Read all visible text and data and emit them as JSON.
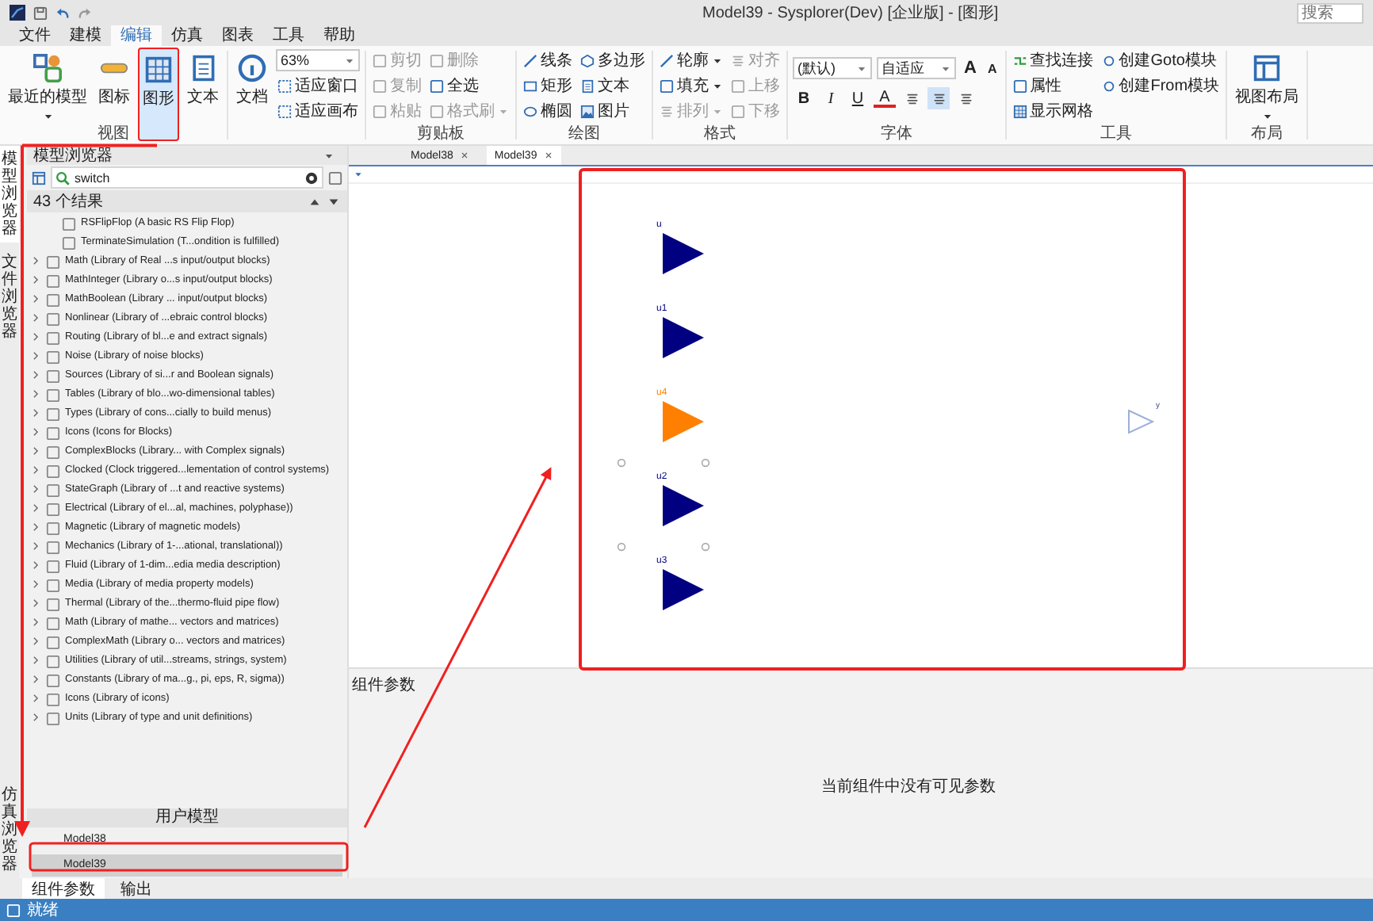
{
  "window": {
    "title": "Model39 - Sysplorer(Dev) [企业版] - [图形]",
    "search_placeholder": "搜索"
  },
  "menu": [
    {
      "label": "文件",
      "selected": false
    },
    {
      "label": "建模",
      "selected": false
    },
    {
      "label": "编辑",
      "selected": true
    },
    {
      "label": "仿真",
      "selected": false
    },
    {
      "label": "图表",
      "selected": false
    },
    {
      "label": "工具",
      "selected": false
    },
    {
      "label": "帮助",
      "selected": false
    }
  ],
  "ribbon": [
    {
      "label": "视图",
      "kind": "grid",
      "items": [
        {
          "kind": "large",
          "label": "最近的模型",
          "selected": false,
          "dropdown": true
        },
        {
          "kind": "large",
          "label": "图标",
          "selected": false,
          "dropdown": false
        },
        {
          "kind": "large",
          "label": "图形",
          "selected": true,
          "dropdown": false
        },
        {
          "kind": "large",
          "label": "文本",
          "selected": false,
          "dropdown": false
        }
      ]
    },
    {
      "kind": "grid",
      "items": [
        {
          "kind": "large",
          "label": "文档",
          "selected": false,
          "dropdown": false
        },
        {
          "kind": "combo",
          "value": "63%"
        },
        {
          "kind": "small",
          "label": "适应窗口",
          "disabled": false,
          "dropdown": false
        },
        {
          "kind": "small",
          "label": "适应画布",
          "disabled": false,
          "dropdown": false
        }
      ]
    },
    {
      "label": "剪贴板",
      "kind": "grid",
      "items": [
        {
          "kind": "small",
          "label": "剪切",
          "disabled": true,
          "dropdown": false
        },
        {
          "kind": "small",
          "label": "复制",
          "disabled": true,
          "dropdown": false
        },
        {
          "kind": "small",
          "label": "粘贴",
          "disabled": true,
          "dropdown": false
        },
        {
          "kind": "small",
          "label": "删除",
          "disabled": true,
          "dropdown": false
        },
        {
          "kind": "small",
          "label": "全选",
          "disabled": false,
          "dropdown": false
        },
        {
          "kind": "small",
          "label": "格式刷",
          "disabled": true,
          "dropdown": true
        }
      ]
    },
    {
      "label": "绘图",
      "kind": "grid",
      "items": [
        {
          "kind": "small",
          "label": "线条",
          "disabled": false,
          "dropdown": false
        },
        {
          "kind": "small",
          "label": "矩形",
          "disabled": false,
          "dropdown": false
        },
        {
          "kind": "small",
          "label": "椭圆",
          "disabled": false,
          "dropdown": false
        },
        {
          "kind": "small",
          "label": "多边形",
          "disabled": false,
          "dropdown": false
        },
        {
          "kind": "small",
          "label": "文本",
          "disabled": false,
          "dropdown": false
        },
        {
          "kind": "small",
          "label": "图片",
          "disabled": false,
          "dropdown": false
        }
      ]
    },
    {
      "label": "格式",
      "kind": "grid",
      "items": [
        {
          "kind": "small",
          "label": "轮廓",
          "disabled": false,
          "dropdown": true
        },
        {
          "kind": "small",
          "label": "填充",
          "disabled": false,
          "dropdown": true
        },
        {
          "kind": "small",
          "label": "排列",
          "disabled": true,
          "dropdown": true
        },
        {
          "kind": "small",
          "label": "对齐",
          "disabled": true,
          "dropdown": false
        },
        {
          "kind": "small",
          "label": "上移",
          "disabled": true,
          "dropdown": false
        },
        {
          "kind": "small",
          "label": "下移",
          "disabled": true,
          "dropdown": false
        }
      ]
    },
    {
      "label": "字体",
      "kind": "font",
      "combos": [
        "(默认)",
        "自适应"
      ],
      "size_buttons": [
        "A",
        "A"
      ],
      "style_buttons": [
        "B",
        "I",
        "U",
        "A"
      ],
      "align": [
        {
          "selected": false
        },
        {
          "selected": true
        },
        {
          "selected": false
        }
      ]
    },
    {
      "label": "工具",
      "kind": "grid",
      "items": [
        {
          "kind": "small",
          "label": "查找连接",
          "disabled": false,
          "dropdown": false
        },
        {
          "kind": "small",
          "label": "属性",
          "disabled": false,
          "dropdown": false
        },
        {
          "kind": "small",
          "label": "显示网格",
          "disabled": false,
          "dropdown": false
        },
        {
          "kind": "small",
          "label": "创建Goto模块",
          "disabled": false,
          "dropdown": false
        },
        {
          "kind": "small",
          "label": "创建From模块",
          "disabled": false,
          "dropdown": false
        }
      ]
    },
    {
      "label": "布局",
      "kind": "grid",
      "items": [
        {
          "kind": "large",
          "label": "视图布局",
          "selected": false,
          "dropdown": true
        }
      ]
    }
  ],
  "side_tabs": [
    {
      "label": "模型浏览器",
      "selected": true
    },
    {
      "label": "文件浏览器",
      "selected": false
    }
  ],
  "side_tabs_bottom": [
    {
      "label": "仿真浏览器",
      "selected": false
    }
  ],
  "browser": {
    "title": "模型浏览器",
    "search": "switch",
    "result_count": "43 个结果",
    "items": [
      {
        "label": "RSFlipFlop (A basic RS Flip Flop)",
        "expandable": false
      },
      {
        "label": "TerminateSimulation (T...ondition is fulfilled)",
        "expandable": false
      },
      {
        "label": "Math (Library of Real ...s input/output blocks)",
        "expandable": true
      },
      {
        "label": "MathInteger (Library o...s input/output blocks)",
        "expandable": true
      },
      {
        "label": "MathBoolean (Library ... input/output blocks)",
        "expandable": true
      },
      {
        "label": "Nonlinear (Library of ...ebraic control blocks)",
        "expandable": true
      },
      {
        "label": "Routing (Library of bl...e and extract signals)",
        "expandable": true
      },
      {
        "label": "Noise (Library of noise blocks)",
        "expandable": true
      },
      {
        "label": "Sources (Library of si...r and Boolean signals)",
        "expandable": true
      },
      {
        "label": "Tables (Library of blo...wo-dimensional tables)",
        "expandable": true
      },
      {
        "label": "Types (Library of cons...cially to build menus)",
        "expandable": true
      },
      {
        "label": "Icons (Icons for Blocks)",
        "expandable": true
      },
      {
        "label": "ComplexBlocks (Library... with Complex signals)",
        "expandable": true
      },
      {
        "label": "Clocked (Clock triggered...lementation of control systems)",
        "expandable": true
      },
      {
        "label": "StateGraph (Library of ...t and reactive systems)",
        "expandable": true
      },
      {
        "label": "Electrical (Library of el...al, machines, polyphase))",
        "expandable": true
      },
      {
        "label": "Magnetic (Library of magnetic models)",
        "expandable": true
      },
      {
        "label": "Mechanics (Library of 1-...ational, translational))",
        "expandable": true
      },
      {
        "label": "Fluid (Library of 1-dim...edia media description)",
        "expandable": true
      },
      {
        "label": "Media (Library of media property models)",
        "expandable": true
      },
      {
        "label": "Thermal (Library of the...thermo-fluid pipe flow)",
        "expandable": true
      },
      {
        "label": "Math (Library of mathe... vectors and matrices)",
        "expandable": true
      },
      {
        "label": "ComplexMath (Library o... vectors and matrices)",
        "expandable": true
      },
      {
        "label": "Utilities (Library of util...streams, strings, system)",
        "expandable": true
      },
      {
        "label": "Constants (Library of ma...g., pi, eps, R, sigma))",
        "expandable": true
      },
      {
        "label": "Icons (Library of icons)",
        "expandable": true
      },
      {
        "label": "Units (Library of type and unit definitions)",
        "expandable": true
      }
    ],
    "user_section": "用户模型",
    "user_models": [
      {
        "label": "Model38",
        "selected": false
      },
      {
        "label": "Model39",
        "selected": true
      }
    ]
  },
  "doc_tabs": [
    {
      "label": "Model38",
      "selected": false
    },
    {
      "label": "Model39",
      "selected": true
    }
  ],
  "canvas": {
    "inputs": [
      {
        "label": "u",
        "color": "#000080",
        "selected": false
      },
      {
        "label": "u1",
        "color": "#000080",
        "selected": false
      },
      {
        "label": "u4",
        "color": "#ff8000",
        "selected": false
      },
      {
        "label": "u2",
        "color": "#000080",
        "selected": true
      },
      {
        "label": "u3",
        "color": "#000080",
        "selected": false
      }
    ],
    "output": {
      "label": "y"
    }
  },
  "params": {
    "title": "组件参数",
    "message": "当前组件中没有可见参数"
  },
  "bottom_tabs": [
    {
      "label": "组件参数",
      "selected": true
    },
    {
      "label": "输出",
      "selected": false
    }
  ],
  "status": "就绪"
}
